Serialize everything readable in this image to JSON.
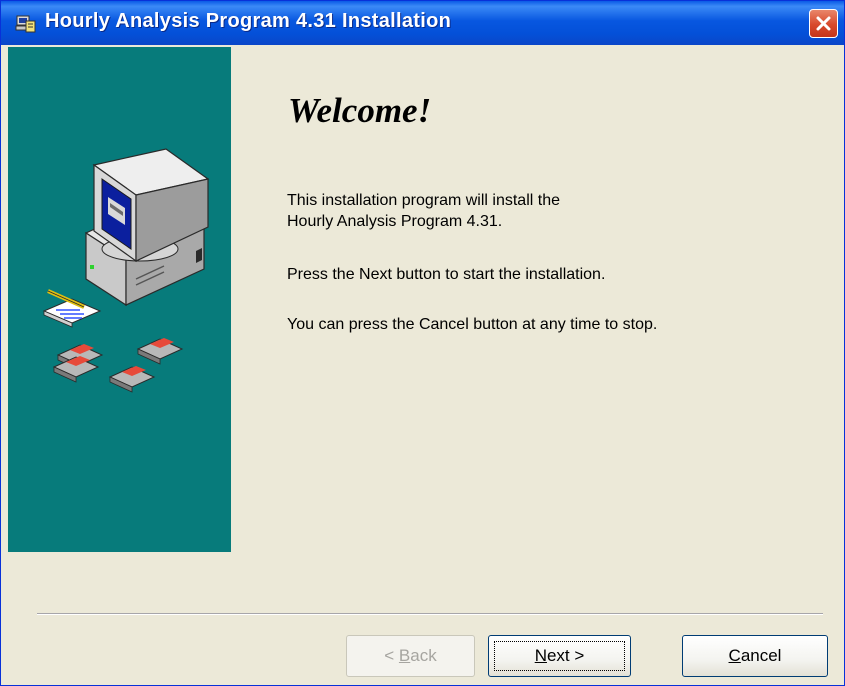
{
  "window": {
    "title": "Hourly Analysis Program 4.31 Installation"
  },
  "icons": {
    "app": "installer-icon",
    "close": "close-icon",
    "illustration": "computer-and-floppy-disks-illustration"
  },
  "colors": {
    "titlebar": "#0a5ae6",
    "side_panel": "#077b7b",
    "dialog_background": "#ece9d8",
    "close_button": "#d8492b"
  },
  "content": {
    "heading": "Welcome!",
    "line1": "This installation program will install the",
    "line2": "Hourly Analysis Program 4.31.",
    "line3": "Press the Next button to start the installation.",
    "line4": "You can press the Cancel button at any time to stop."
  },
  "buttons": {
    "back": {
      "label_prefix": "< ",
      "accel": "B",
      "label_rest": "ack",
      "enabled": false
    },
    "next": {
      "accel": "N",
      "label_rest": "ext >",
      "enabled": true,
      "focused": true
    },
    "cancel": {
      "accel": "C",
      "label_rest": "ancel",
      "enabled": true
    }
  }
}
